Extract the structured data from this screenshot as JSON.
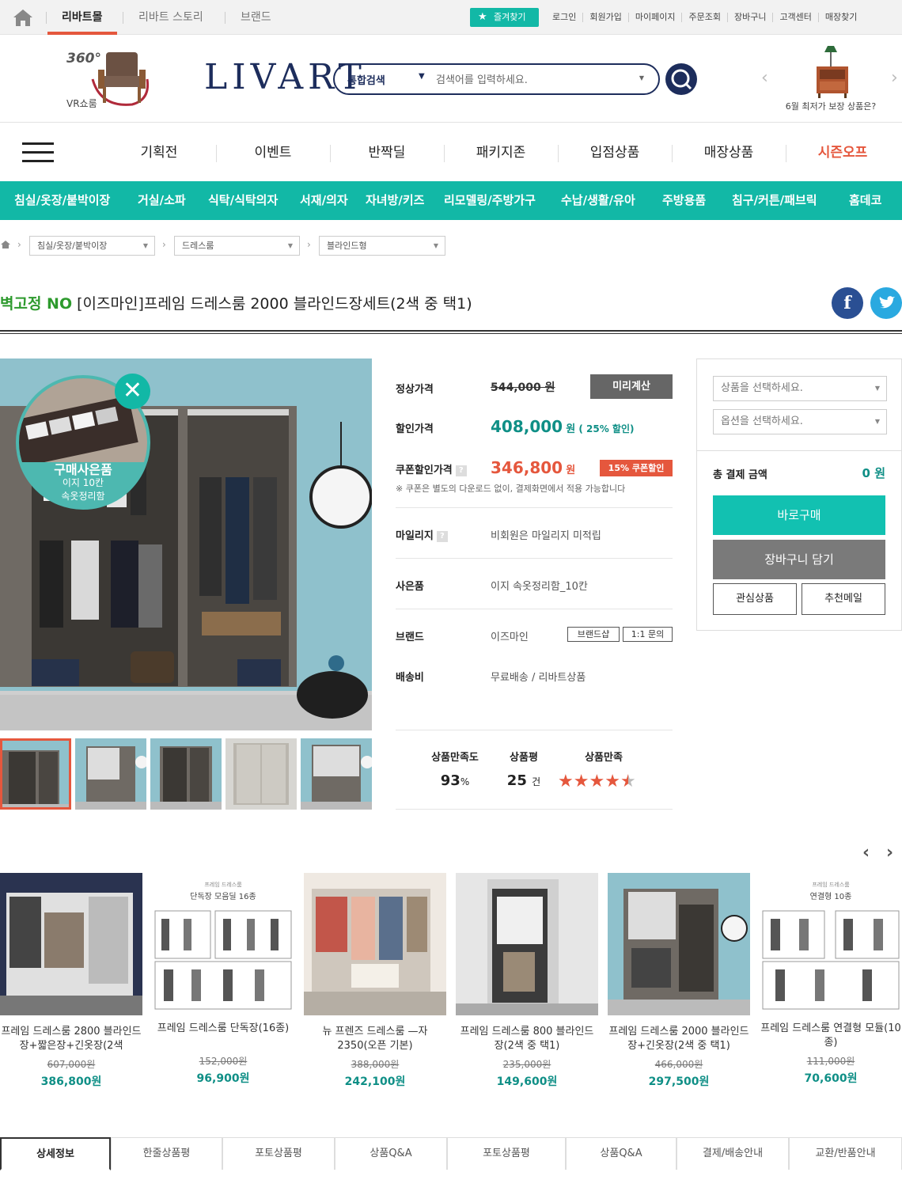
{
  "topbar": {
    "tabs": [
      "리바트몰",
      "리바트 스토리",
      "브랜드"
    ],
    "favorite": "즐겨찾기",
    "util": [
      "로그인",
      "회원가입",
      "마이페이지",
      "주문조회",
      "장바구니",
      "고객센터",
      "매장찾기"
    ]
  },
  "header": {
    "vr_360": "360°",
    "vr_label": "VR쇼룸",
    "logo": "LIVART",
    "search_category": "통합검색",
    "search_placeholder": "검색어를 입력하세요.",
    "promo_text": "6월 최저가 보장 상품은?"
  },
  "gnb": [
    "기획전",
    "이벤트",
    "반짝딜",
    "패키지존",
    "입점상품",
    "매장상품",
    "시즌오프"
  ],
  "categories": [
    "침실/옷장/붙박이장",
    "거실/소파",
    "식탁/식탁의자",
    "서재/의자",
    "자녀방/키즈",
    "리모델링/주방가구",
    "수납/생활/유아",
    "주방용품",
    "침구/커튼/패브릭",
    "홈데코"
  ],
  "breadcrumb": [
    "침실/옷장/붙박이장",
    "드레스룸",
    "블라인드형"
  ],
  "product": {
    "badge": "벽고정 NO",
    "title": " [이즈마인]프레임 드레스룸 2000 블라인드장세트(2색 중 택1)",
    "gift_title": "구매사은품",
    "gift_sub1": "이지 10칸",
    "gift_sub2": "속옷정리함",
    "labels": {
      "regular": "정상가격",
      "discount": "할인가격",
      "coupon": "쿠폰할인가격",
      "mileage": "마일리지",
      "gift": "사은품",
      "brand": "브랜드",
      "shipping": "배송비"
    },
    "regular_price": "544,000 원",
    "precalc": "미리계산",
    "discount_price": "408,000",
    "discount_unit": "원",
    "discount_rate": "( 25% 할인)",
    "coupon_price": "346,800",
    "coupon_unit": "원",
    "coupon_badge": "15% 쿠폰할인",
    "coupon_note": "※ 쿠폰은 별도의 다운로드 없이, 결제화면에서 적용 가능합니다",
    "help_mark": "?",
    "mileage": "비회원은 마일리지 미적립",
    "gift": "이지 속옷정리함_10칸",
    "brand": "이즈마인",
    "brand_shop": "브랜드샵",
    "inquiry": "1:1 문의",
    "shipping": "무료배송 / 리바트상품",
    "rating": {
      "satisfaction_label": "상품만족도",
      "satisfaction": "93",
      "satisfaction_unit": "%",
      "reviews_label": "상품평",
      "reviews": "25",
      "reviews_unit": "건",
      "stars_label": "상품만족",
      "stars": 4.5
    }
  },
  "panel": {
    "select_product": "상품을 선택하세요.",
    "select_option": "옵션을 선택하세요.",
    "total_label": "총 결제 금액",
    "total": "0 원",
    "buy": "바로구매",
    "cart": "장바구니 담기",
    "wish": "관심상품",
    "recommend": "추천메일"
  },
  "related": [
    {
      "name": "프레임 드레스룸 2800 블라인드장+짧은장+긴옷장(2색",
      "old": "607,000원",
      "price": "386,800원"
    },
    {
      "name": "프레임 드레스룸 단독장(16종)",
      "old": "152,000원",
      "price": "96,900원",
      "caption": "프레임 드레스룸",
      "heading": "단독장 모음딜 16종"
    },
    {
      "name": "뉴 프렌즈 드레스룸 —자 2350(오픈 기본)",
      "old": "388,000원",
      "price": "242,100원"
    },
    {
      "name": "프레임 드레스룸 800 블라인드장(2색 중 택1)",
      "old": "235,000원",
      "price": "149,600원"
    },
    {
      "name": "프레임 드레스룸 2000 블라인드장+긴옷장(2색 중 택1)",
      "old": "466,000원",
      "price": "297,500원"
    },
    {
      "name": "프레임 드레스룸 연결형 모듈(10종)",
      "old": "111,000원",
      "price": "70,600원",
      "caption": "프레임 드레스룸",
      "heading": "연결형 10종"
    }
  ],
  "tabs": [
    "상세정보",
    "한줄상품평",
    "포토상품평",
    "상품Q&A",
    "포토상품평",
    "상품Q&A",
    "결제/배송안내",
    "교환/반품안내"
  ],
  "colors": {
    "accent": "#12b8a6",
    "sale": "#e5573d",
    "brand": "#1d2d5c",
    "price": "#0f8f86"
  }
}
